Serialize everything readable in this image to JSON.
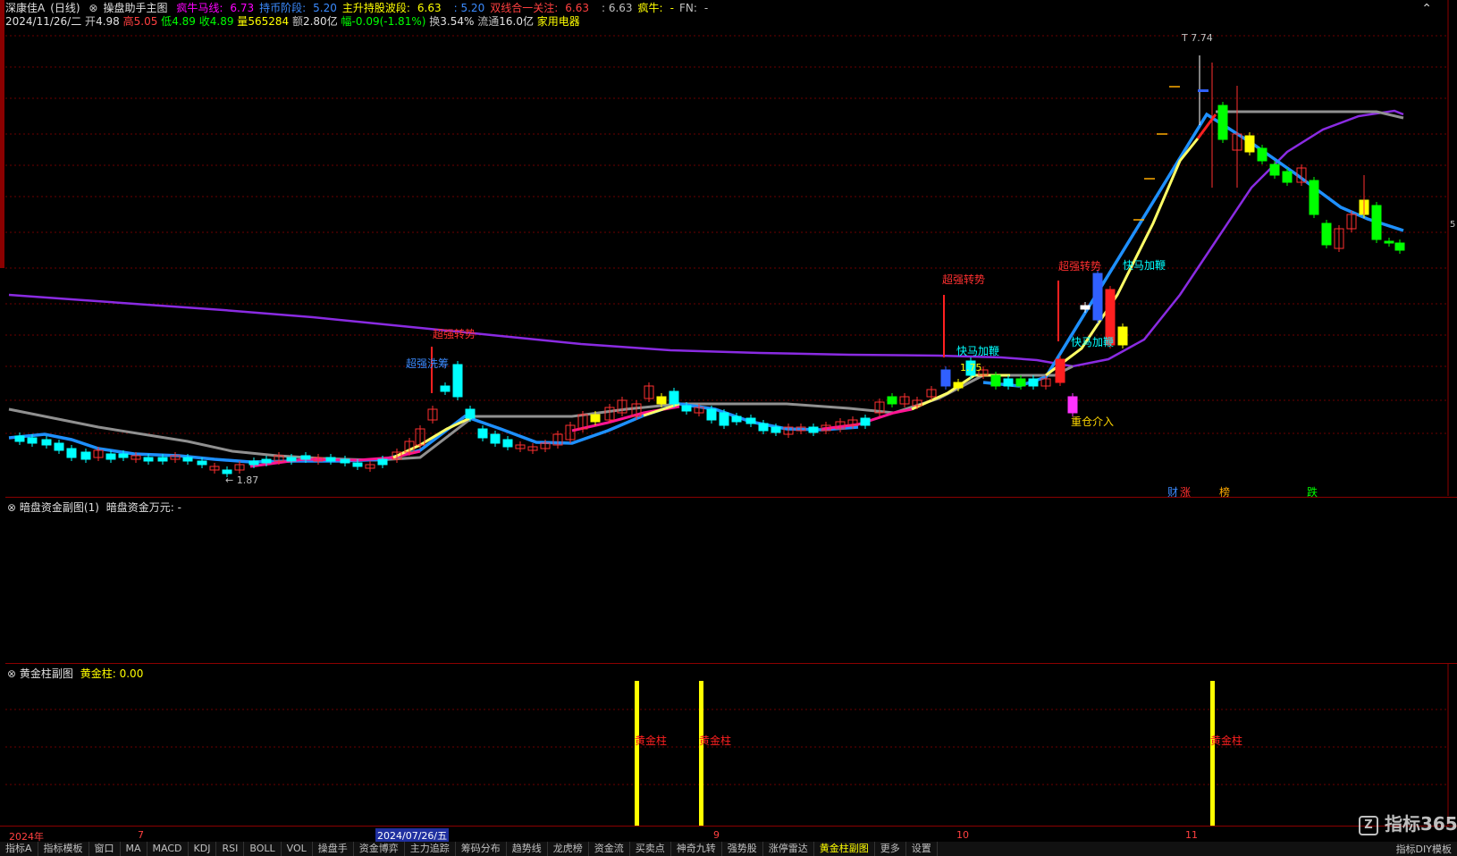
{
  "header": {
    "stock": "深康佳A",
    "period": "(日线)",
    "indicator": "操盘助手主图",
    "items": [
      {
        "label": "疯牛马线:",
        "value": "6.73",
        "color": "#ff00ff"
      },
      {
        "label": "持币阶段:",
        "value": "5.20",
        "color": "#3b8bff"
      },
      {
        "label": "主升持股波段:",
        "value": "6.63",
        "color": "#ffff00"
      },
      {
        "label": "",
        "value": ": 5.20",
        "color": "#3b8bff"
      },
      {
        "label": "双线合一关注:",
        "value": "6.63",
        "color": "#ff4040"
      },
      {
        "label": "",
        "value": ": 6.63",
        "color": "#c0c0c0"
      },
      {
        "label": "疯牛:",
        "value": "-",
        "color": "#ffff00"
      },
      {
        "label": "FN:",
        "value": "-",
        "color": "#c0c0c0"
      }
    ],
    "info": {
      "date": "2024/11/26/二",
      "open_label": "开",
      "open": "4.98",
      "high_label": "高",
      "high": "5.05",
      "low_label": "低",
      "low": "4.89",
      "close_label": "收",
      "close": "4.89",
      "vol_label": "量",
      "vol": "565284",
      "amt_label": "额",
      "amt": "2.80亿",
      "chg_label": "幅",
      "chg": "-0.09(-1.81%)",
      "turn_label": "换",
      "turn": "3.54%",
      "float_label": "流通",
      "float": "16.0亿",
      "sector": "家用电器"
    }
  },
  "annotations": {
    "high_price": "7.74",
    "low_price": "1.87",
    "mid_price": "1.75",
    "cq1": "超强转势",
    "cq2": "超强洗筹",
    "cq3": "超强转势",
    "cq4": "超强转势",
    "km1": "快马加鞭",
    "km2": "快马加鞭",
    "km3": "快马加鞭",
    "zc": "重仓介入",
    "cai": "财",
    "zhang": "涨",
    "bang": "榜",
    "die": "跌",
    "right_label": "5"
  },
  "panel2": {
    "title": "暗盘资金副图(1)",
    "label": "暗盘资金万元:",
    "value": "-"
  },
  "panel3": {
    "title": "黄金柱副图",
    "label": "黄金柱:",
    "value": "0.00",
    "bar_label": "黄金柱"
  },
  "date_axis": {
    "labels": [
      "2024年",
      "7",
      "2024/07/26/五",
      "9",
      "10",
      "11"
    ]
  },
  "tabs": [
    "指标A",
    "指标模板",
    "窗口",
    "MA",
    "MACD",
    "KDJ",
    "RSI",
    "BOLL",
    "VOL",
    "操盘手",
    "资金博弈",
    "主力追踪",
    "筹码分布",
    "趋势线",
    "龙虎榜",
    "资金流",
    "买卖点",
    "神奇九转",
    "强势股",
    "涨停雷达",
    "黄金柱副图",
    "更多",
    "设置"
  ],
  "tab_active": 20,
  "logo": "指标365",
  "bottom_right": "指标DIY模板"
}
